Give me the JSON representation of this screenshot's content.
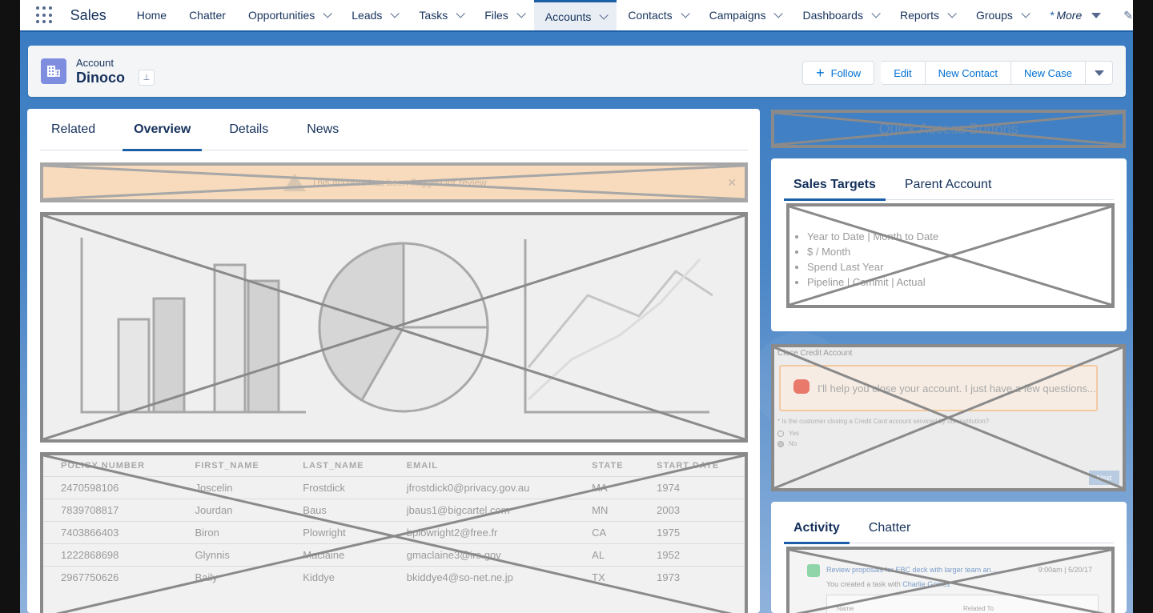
{
  "nav": {
    "app_name": "Sales",
    "items": [
      {
        "label": "Home"
      },
      {
        "label": "Chatter"
      },
      {
        "label": "Opportunities"
      },
      {
        "label": "Leads"
      },
      {
        "label": "Tasks"
      },
      {
        "label": "Files"
      },
      {
        "label": "Accounts"
      },
      {
        "label": "Contacts"
      },
      {
        "label": "Campaigns"
      },
      {
        "label": "Dashboards"
      },
      {
        "label": "Reports"
      },
      {
        "label": "Groups"
      }
    ],
    "more_star": "*",
    "more_label": "More"
  },
  "header": {
    "object_label": "Account",
    "record_name": "Dinoco",
    "actions": {
      "follow": "Follow",
      "edit": "Edit",
      "new_contact": "New Contact",
      "new_case": "New Case"
    }
  },
  "main_tabs": [
    "Related",
    "Overview",
    "Details",
    "News"
  ],
  "alert": {
    "text": "This account has been flagged for review"
  },
  "table": {
    "headers": [
      "POLICY NUMBER",
      "FIRST_NAME",
      "LAST_NAME",
      "EMAIL",
      "STATE",
      "START DATE"
    ],
    "rows": [
      [
        "2470598106",
        "Joscelin",
        "Frostdick",
        "jfrostdick0@privacy.gov.au",
        "MA",
        "1974"
      ],
      [
        "7839708817",
        "Jourdan",
        "Baus",
        "jbaus1@bigcartel.com",
        "MN",
        "2003"
      ],
      [
        "7403866403",
        "Biron",
        "Plowright",
        "bplowright2@free.fr",
        "CA",
        "1975"
      ],
      [
        "1222868698",
        "Glynnis",
        "Maclaine",
        "gmaclaine3@irs.gov",
        "AL",
        "1952"
      ],
      [
        "2967750626",
        "Baily",
        "Kiddye",
        "bkiddye4@so-net.ne.jp",
        "TX",
        "1973"
      ]
    ]
  },
  "quick_access": "Quick Access Buttons",
  "side_tabs": [
    "Sales Targets",
    "Parent Account"
  ],
  "targets": [
    "Year to Date | Month to Date",
    "$ / Month",
    "Spend Last Year",
    "Pipeline | Commit | Actual"
  ],
  "credit": {
    "title": "Close Credit Account",
    "message": "I'll help you close your account. I just have a few questions...",
    "question": "* Is the customer closing a Credit Card account serviced by our institution?",
    "option_yes": "Yes",
    "option_no": "No",
    "next": "Next"
  },
  "activity_tabs": [
    "Activity",
    "Chatter"
  ],
  "activity": {
    "subject": "Review proposals for EBC deck with larger team an...",
    "date": "9:00am | 5/20/17",
    "sub_prefix": "You created a task with",
    "sub_name": "Charlie Gomez",
    "col_name": "Name",
    "col_related": "Related To"
  },
  "colors": {
    "brand": "#1b5fa6",
    "link": "#0070d2",
    "account_icon": "#7f8de1",
    "alert": "#f5cfa6"
  }
}
